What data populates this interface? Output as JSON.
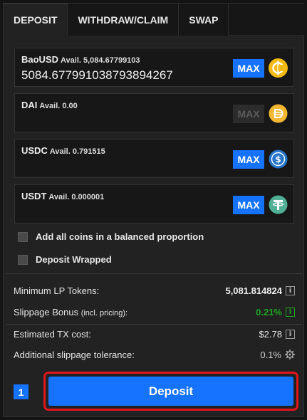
{
  "tabs": [
    {
      "label": "DEPOSIT",
      "active": true
    },
    {
      "label": "WITHDRAW/CLAIM",
      "active": false
    },
    {
      "label": "SWAP",
      "active": false
    }
  ],
  "coins": [
    {
      "name": "BaoUSD",
      "avail_label": "Avail. 5,084.67799103",
      "value": "5084.677991038793894267",
      "max_label": "MAX",
      "max_enabled": true,
      "icon": "baousd-icon",
      "icon_color": "#f5ba14"
    },
    {
      "name": "DAI",
      "avail_label": "Avail. 0.00",
      "value": "",
      "max_label": "MAX",
      "max_enabled": false,
      "icon": "dai-icon",
      "icon_color": "#f4b731"
    },
    {
      "name": "USDC",
      "avail_label": "Avail. 0.791515",
      "value": "",
      "max_label": "MAX",
      "max_enabled": true,
      "icon": "usdc-icon",
      "icon_color": "#2775ca"
    },
    {
      "name": "USDT",
      "avail_label": "Avail. 0.000001",
      "value": "",
      "max_label": "MAX",
      "max_enabled": true,
      "icon": "usdt-icon",
      "icon_color": "#50af95"
    }
  ],
  "options": {
    "balanced_label": "Add all coins in a balanced proportion",
    "wrapped_label": "Deposit Wrapped",
    "balanced_checked": false,
    "wrapped_checked": false
  },
  "stats": {
    "min_lp_label": "Minimum LP Tokens:",
    "min_lp_value": "5,081.814824",
    "slippage_label": "Slippage Bonus",
    "slippage_sub": "(incl. pricing):",
    "slippage_value": "0.21%",
    "slippage_color": "#1fa521",
    "tx_cost_label": "Estimated TX cost:",
    "tx_cost_value": "$2.78",
    "tolerance_label": "Additional slippage tolerance:",
    "tolerance_value": "0.1%"
  },
  "action": {
    "step": "1",
    "deposit_label": "Deposit"
  },
  "colors": {
    "accent": "#1673ff",
    "highlight_outline": "#e0161c"
  }
}
